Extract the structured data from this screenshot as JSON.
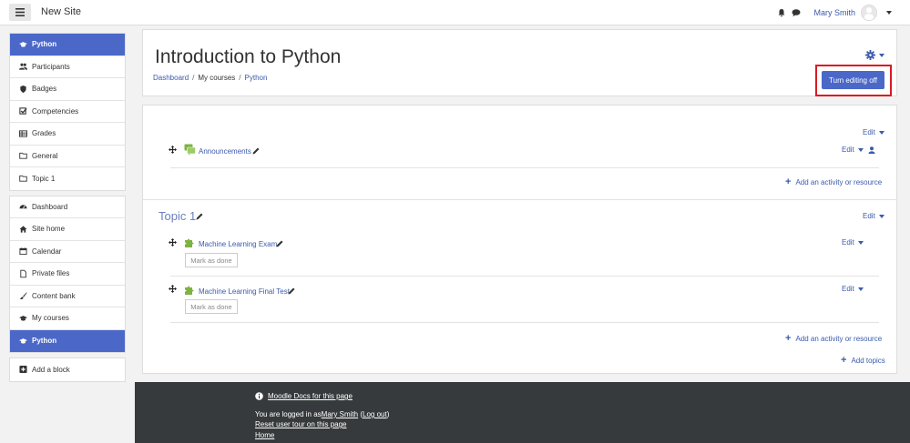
{
  "navbar": {
    "site_name": "New Site",
    "user_name": "Mary Smith"
  },
  "drawer": {
    "course": [
      {
        "label": "Python",
        "icon": "graduation-cap-icon",
        "active": true
      },
      {
        "label": "Participants",
        "icon": "users-icon"
      },
      {
        "label": "Badges",
        "icon": "shield-icon"
      },
      {
        "label": "Competencies",
        "icon": "checkbox-icon"
      },
      {
        "label": "Grades",
        "icon": "table-icon"
      },
      {
        "label": "General",
        "icon": "folder-icon"
      },
      {
        "label": "Topic 1",
        "icon": "folder-icon"
      }
    ],
    "site": [
      {
        "label": "Dashboard",
        "icon": "dashboard-icon"
      },
      {
        "label": "Site home",
        "icon": "home-icon"
      },
      {
        "label": "Calendar",
        "icon": "calendar-icon"
      },
      {
        "label": "Private files",
        "icon": "file-icon"
      },
      {
        "label": "Content bank",
        "icon": "brush-icon"
      },
      {
        "label": "My courses",
        "icon": "graduation-cap-icon"
      },
      {
        "label": "Python",
        "icon": "graduation-cap-icon",
        "active": true
      }
    ],
    "add_block": "Add a block"
  },
  "header": {
    "title": "Introduction to Python",
    "breadcrumb": [
      "Dashboard",
      "My courses",
      "Python"
    ],
    "edit_button": "Turn editing off"
  },
  "course": {
    "edit_label": "Edit",
    "general_section": {
      "activities": [
        {
          "name": "Announcements",
          "icon": "forum-icon"
        }
      ],
      "add_activity": "Add an activity or resource"
    },
    "topic1": {
      "title": "Topic 1",
      "activities": [
        {
          "name": "Machine Learning Exam",
          "icon": "quiz-puzzle-icon",
          "mark": "Mark as done"
        },
        {
          "name": "Machine Learning Final Test",
          "icon": "quiz-puzzle-icon",
          "mark": "Mark as done"
        }
      ],
      "add_activity": "Add an activity or resource"
    },
    "add_topics": "Add topics"
  },
  "footer": {
    "docs_link": "Moodle Docs for this page",
    "logged_in_prefix": "You are logged in as ",
    "logged_in_user": "Mary Smith",
    "logout": "Log out",
    "reset_tour": "Reset user tour on this page",
    "home": "Home"
  },
  "colors": {
    "primary": "#4b68c8",
    "link": "#3a5aad",
    "highlight_border": "#d91b24",
    "footer_bg": "#373a3c",
    "activity_green": "#7cb342"
  }
}
